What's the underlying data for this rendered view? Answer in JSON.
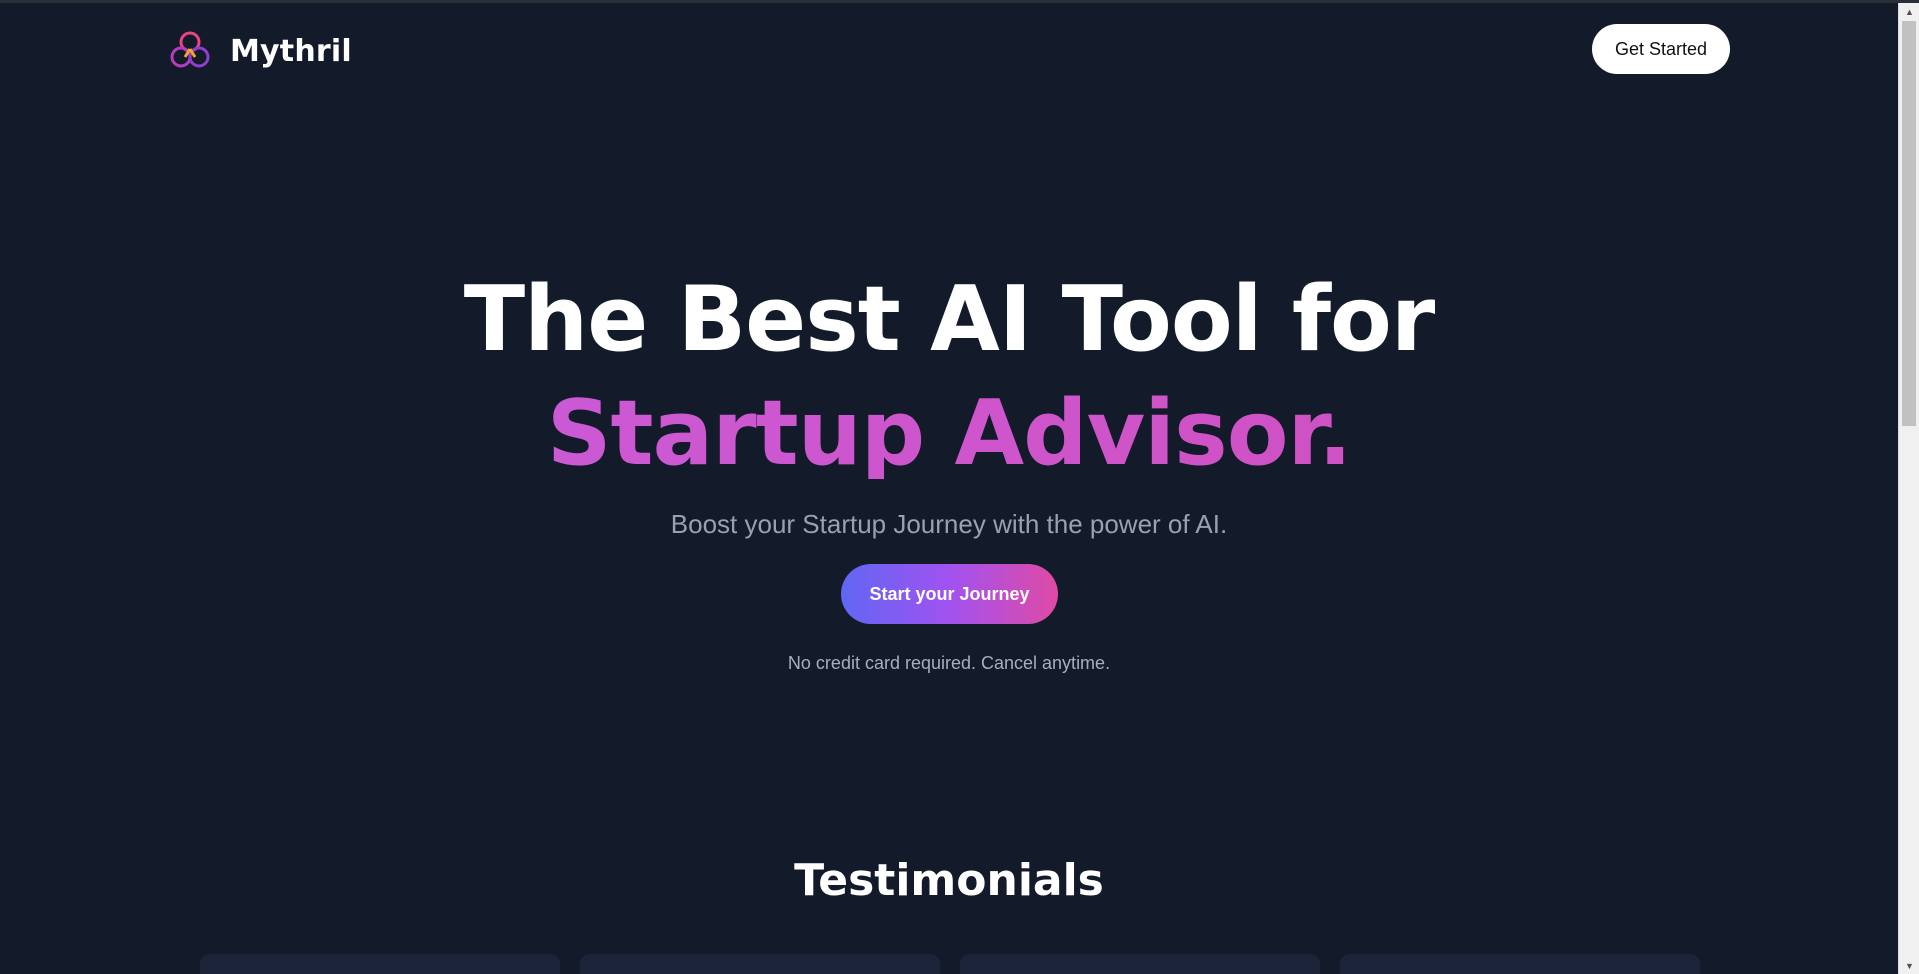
{
  "header": {
    "brand_name": "Mythril",
    "logo_icon": "triple-ring-logo-icon",
    "cta_label": "Get Started"
  },
  "hero": {
    "title_line1": "The Best AI Tool for",
    "title_line2": "Startup Advisor.",
    "subtitle": "Boost your Startup Journey with the power of AI.",
    "cta_label": "Start your Journey",
    "note": "No credit card required. Cancel anytime."
  },
  "testimonials": {
    "title": "Testimonials"
  },
  "colors": {
    "background": "#131a2a",
    "gradient_title_start": "#c95fe0",
    "gradient_title_end": "#d24cb8",
    "cta_gradient": [
      "#6067f4",
      "#a152f0",
      "#e04aa5"
    ]
  }
}
